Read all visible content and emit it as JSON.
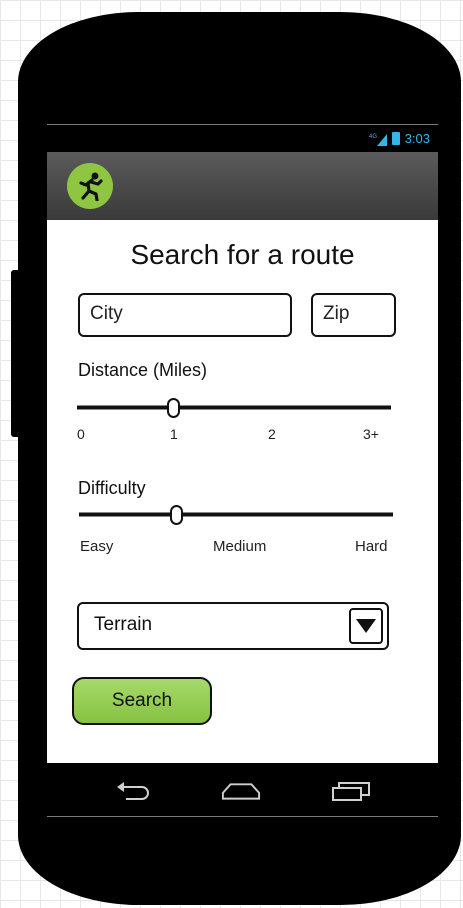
{
  "status_bar": {
    "network": "4G",
    "time": "3:03"
  },
  "action_bar": {
    "app_icon": "runner-icon",
    "accent": "#8fc641"
  },
  "screen": {
    "title": "Search for a route",
    "city": {
      "placeholder": "City"
    },
    "zip": {
      "placeholder": "Zip"
    },
    "distance": {
      "label": "Distance (Miles)",
      "ticks": [
        "0",
        "1",
        "2",
        "3+"
      ],
      "value": "1"
    },
    "difficulty": {
      "label": "Difficulty",
      "ticks": [
        "Easy",
        "Medium",
        "Hard"
      ],
      "value_fraction": 0.33
    },
    "terrain": {
      "selected": "Terrain",
      "icon": "dropdown-triangle-icon"
    },
    "search_button": {
      "label": "Search",
      "color": "#8fc641"
    }
  },
  "nav_bar": {
    "icons": [
      "back-icon",
      "home-icon",
      "recents-icon"
    ]
  }
}
